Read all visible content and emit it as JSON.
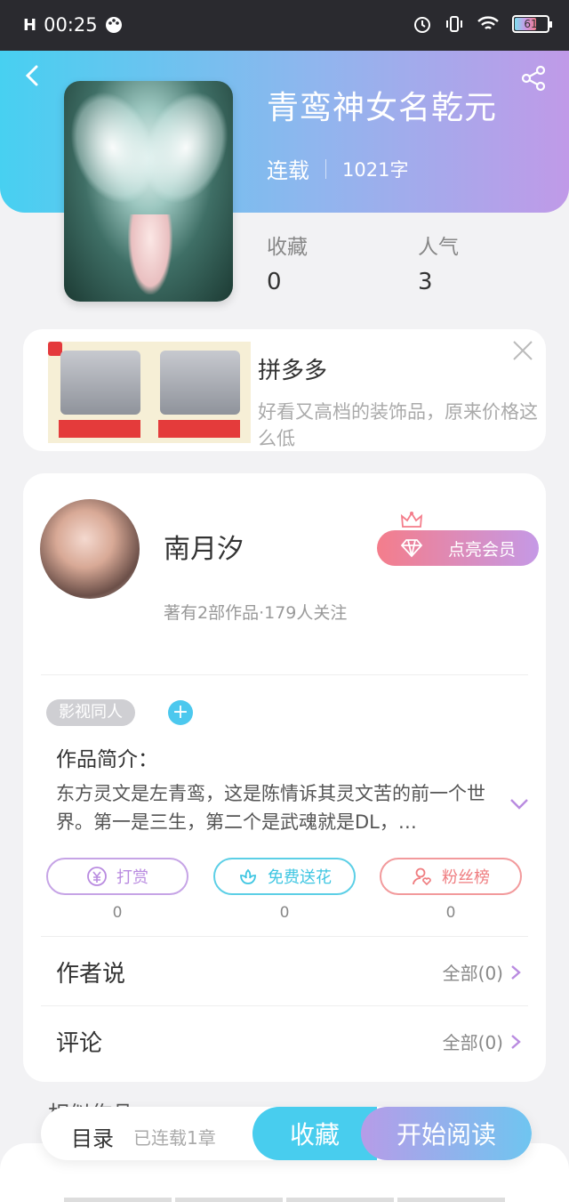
{
  "status_bar": {
    "network": "H",
    "time": "00:25",
    "battery": "61"
  },
  "book": {
    "title": "青鸾神女名乾元",
    "status": "连载",
    "word_count": "1021字",
    "stats": [
      {
        "label": "收藏",
        "value": "0"
      },
      {
        "label": "人气",
        "value": "3"
      }
    ]
  },
  "ad": {
    "title": "拼多多",
    "description": "好看又高档的装饰品，原来价格这么低"
  },
  "author": {
    "name": "南月汐",
    "info": "著有2部作品·179人关注",
    "vip_label": "点亮会员"
  },
  "tags": [
    "影视同人"
  ],
  "intro": {
    "title": "作品简介：",
    "text": "东方灵文是左青鸾，这是陈情诉其灵文苦的前一个世界。第一是三生，第二个是武魂就是DL，…"
  },
  "actions": [
    {
      "label": "打赏",
      "count": "0",
      "color": "#b98be0"
    },
    {
      "label": "免费送花",
      "count": "0",
      "color": "#3fc6e2"
    },
    {
      "label": "粉丝榜",
      "count": "0",
      "color": "#ef7d80"
    }
  ],
  "sections": [
    {
      "label": "作者说",
      "link": "全部(0)"
    },
    {
      "label": "评论",
      "link": "全部(0)"
    }
  ],
  "similar_title": "相似作品",
  "bottom_bar": {
    "toc": "目录",
    "chapters": "已连载1章",
    "collect": "收藏",
    "read": "开始阅读"
  },
  "colors": {
    "accent_blue": "#48cdee",
    "accent_purple": "#c09ae8",
    "accent_pink": "#f47d8b"
  }
}
